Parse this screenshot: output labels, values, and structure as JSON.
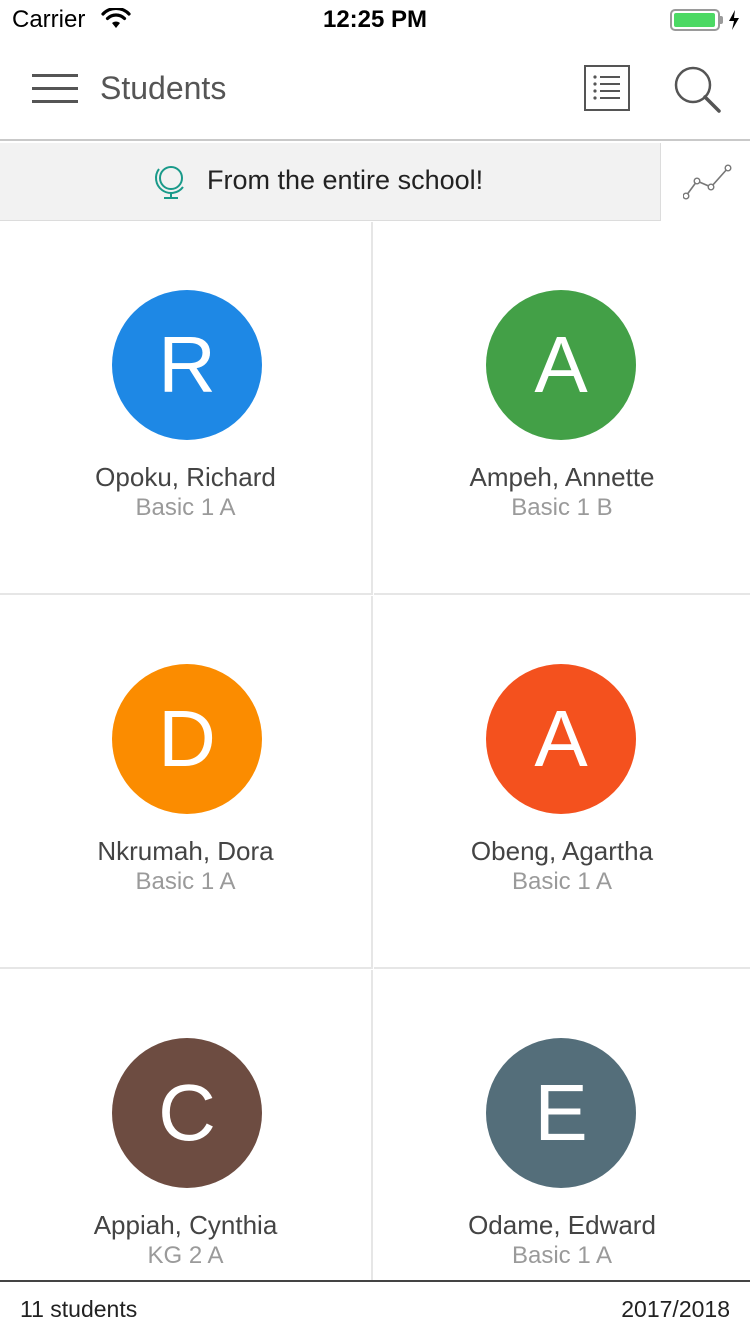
{
  "status_bar": {
    "carrier": "Carrier",
    "time": "12:25 PM",
    "battery_color": "#4cd964"
  },
  "header": {
    "title": "Students",
    "left_icon": "hamburger-menu-icon",
    "right_icons": [
      "list-view-icon",
      "search-icon"
    ]
  },
  "filter": {
    "icon": "globe-icon",
    "text": "From the entire school!",
    "chart_icon": "line-chart-icon"
  },
  "students": [
    {
      "initial": "R",
      "name": "Opoku, Richard",
      "class": "Basic 1 A",
      "color": "#1e88e5"
    },
    {
      "initial": "A",
      "name": "Ampeh, Annette",
      "class": "Basic 1 B",
      "color": "#43a047"
    },
    {
      "initial": "D",
      "name": "Nkrumah, Dora",
      "class": "Basic 1 A",
      "color": "#fb8c00"
    },
    {
      "initial": "A",
      "name": "Obeng, Agartha",
      "class": "Basic 1 A",
      "color": "#f4511e"
    },
    {
      "initial": "C",
      "name": "Appiah, Cynthia",
      "class": "KG 2 A",
      "color": "#6d4c41"
    },
    {
      "initial": "E",
      "name": "Odame, Edward",
      "class": "Basic 1 A",
      "color": "#546e7a"
    }
  ],
  "footer": {
    "count": "11 students",
    "year": "2017/2018"
  }
}
